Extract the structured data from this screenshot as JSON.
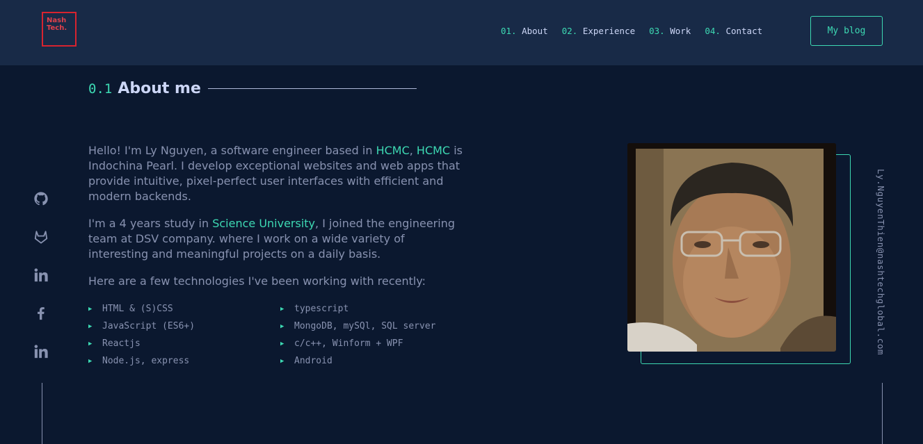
{
  "logo": {
    "line1": "Nash",
    "line2": "Tech."
  },
  "nav": [
    {
      "num": "01.",
      "label": "About"
    },
    {
      "num": "02.",
      "label": "Experience"
    },
    {
      "num": "03.",
      "label": "Work"
    },
    {
      "num": "04.",
      "label": "Contact"
    }
  ],
  "blog_button": "My blog",
  "section": {
    "num": "0.1",
    "title": "About me"
  },
  "about": {
    "p1_a": "Hello! I'm Ly Nguyen, a software engineer based in ",
    "p1_hl1": "HCMC",
    "p1_b": ", ",
    "p1_hl2": "HCMC",
    "p1_c": " is Indochina Pearl. I develop exceptional websites and web apps that provide intuitive, pixel-perfect user interfaces with efficient and modern backends.",
    "p2_a": "I'm a 4 years study in ",
    "p2_hl": "Science University",
    "p2_b": ", I joined the engineering team at DSV company. where I work on a wide variety of interesting and meaningful projects on a daily basis.",
    "p3": "Here are a few technologies I've been working with recently:"
  },
  "technologies": [
    "HTML & (S)CSS",
    "typescript",
    "JavaScript (ES6+)",
    "MongoDB, mySQl, SQL server",
    "Reactjs",
    "c/c++, Winform + WPF",
    "Node.js, express",
    "Android"
  ],
  "socials": [
    "github-icon",
    "gitlab-icon",
    "linkedin-icon",
    "facebook-icon",
    "linkedin-icon"
  ],
  "email": "Ly.NguyenThien@nashtechglobal.com",
  "colors": {
    "background": "#0b182f",
    "header": "#182a47",
    "accent": "#3dd9b3",
    "text": "#8892b0",
    "heading": "#ccd6f6",
    "logo": "#d8232f"
  }
}
